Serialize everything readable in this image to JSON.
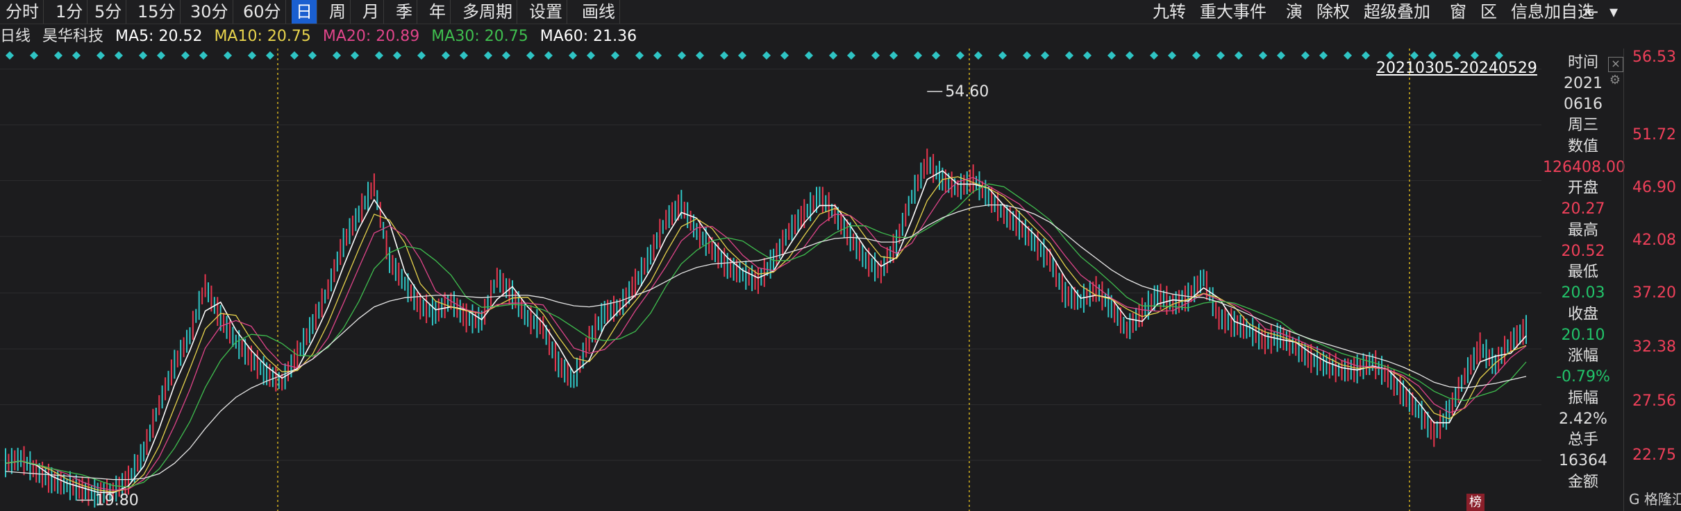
{
  "toolbar": {
    "tabs": [
      {
        "label": "分时",
        "active": false
      },
      {
        "label": "1分",
        "active": false
      },
      {
        "label": "5分",
        "active": false
      },
      {
        "label": "15分",
        "active": false
      },
      {
        "label": "30分",
        "active": false
      },
      {
        "label": "60分",
        "active": false
      },
      {
        "label": "日",
        "active": true
      },
      {
        "label": "周",
        "active": false
      },
      {
        "label": "月",
        "active": false
      },
      {
        "label": "季",
        "active": false
      },
      {
        "label": "年",
        "active": false
      },
      {
        "label": "多周期",
        "active": false
      },
      {
        "label": "设置",
        "active": false
      },
      {
        "label": "画线",
        "active": false
      }
    ],
    "right_tools": [
      "九转",
      "重大事件",
      "演",
      "除权",
      "超级叠加",
      "窗",
      "区",
      "信息加自选"
    ],
    "active_color": "#1a5fd0"
  },
  "ma_bar": {
    "period": "日线",
    "stock_name": "昊华科技",
    "ma5": "MA5: 20.52",
    "ma10": "MA10: 20.75",
    "ma20": "MA20: 20.89",
    "ma30": "MA30: 20.75",
    "ma60": "MA60: 21.36",
    "colors": {
      "ma5": "#ffffff",
      "ma10": "#e8d44d",
      "ma20": "#e0458a",
      "ma30": "#3fbf4f",
      "ma60": "#ffffff"
    }
  },
  "y_axis": {
    "ticks": [
      "56.53",
      "51.72",
      "46.90",
      "42.08",
      "37.20",
      "32.38",
      "27.56",
      "22.75"
    ],
    "color": "#f0405a"
  },
  "info_panel": {
    "date_range": "20210305-20240529",
    "items": [
      {
        "label": "时间",
        "value_lines": [
          "2021",
          "0616",
          "周三"
        ],
        "color": "white"
      },
      {
        "label": "数值",
        "value_lines": [
          "126408.00"
        ],
        "color": "red"
      },
      {
        "label": "开盘",
        "value_lines": [
          "20.27"
        ],
        "color": "red"
      },
      {
        "label": "最高",
        "value_lines": [
          "20.52"
        ],
        "color": "red"
      },
      {
        "label": "最低",
        "value_lines": [
          "20.03"
        ],
        "color": "green"
      },
      {
        "label": "收盘",
        "value_lines": [
          "20.10"
        ],
        "color": "green"
      },
      {
        "label": "涨幅",
        "value_lines": [
          "-0.79%"
        ],
        "color": "green"
      },
      {
        "label": "振幅",
        "value_lines": [
          "2.42%"
        ],
        "color": "white"
      },
      {
        "label": "总手",
        "value_lines": [
          "16364"
        ],
        "color": "white"
      },
      {
        "label": "金额",
        "value_lines": [],
        "color": "white"
      }
    ]
  },
  "chart_data": {
    "type": "line",
    "title": "",
    "xlabel": "",
    "ylabel": "",
    "ylim": [
      20.0,
      58.0
    ],
    "annotations": [
      {
        "text": "54.60",
        "kind": "high",
        "value": 54.6
      },
      {
        "text": "19.80",
        "kind": "low",
        "value": 19.8
      }
    ],
    "price": [
      22.5,
      22.9,
      21.8,
      21.0,
      20.6,
      20.2,
      19.8,
      20.1,
      21.0,
      23.5,
      27.5,
      31.0,
      33.5,
      37.8,
      35.0,
      33.0,
      31.5,
      30.2,
      29.5,
      31.8,
      34.5,
      37.5,
      41.5,
      44.0,
      46.5,
      40.0,
      38.0,
      36.0,
      35.5,
      36.5,
      35.0,
      34.8,
      38.5,
      37.0,
      35.0,
      34.2,
      31.0,
      29.6,
      33.2,
      35.5,
      36.0,
      38.0,
      40.5,
      43.5,
      44.8,
      42.5,
      41.0,
      39.5,
      38.8,
      38.2,
      40.0,
      42.5,
      44.0,
      45.5,
      44.0,
      42.0,
      40.0,
      39.0,
      41.5,
      45.5,
      48.5,
      47.0,
      46.2,
      47.0,
      45.5,
      44.0,
      43.0,
      41.5,
      40.0,
      37.0,
      36.5,
      37.5,
      36.0,
      34.0,
      35.5,
      37.0,
      36.2,
      36.8,
      38.5,
      35.0,
      34.5,
      34.0,
      33.0,
      33.4,
      32.5,
      31.5,
      31.0,
      30.5,
      30.6,
      31.2,
      30.0,
      28.5,
      27.0,
      25.0,
      27.0,
      30.0,
      32.5,
      31.0,
      33.0,
      34.0
    ],
    "ma_long": [
      21.8,
      21.7,
      21.6,
      21.5,
      21.4,
      21.3,
      21.2,
      21.1,
      21.1,
      21.2,
      21.6,
      22.5,
      23.8,
      25.5,
      27.0,
      28.2,
      29.0,
      29.6,
      30.1,
      30.7,
      31.5,
      32.6,
      33.8,
      35.0,
      36.0,
      36.5,
      36.8,
      36.9,
      37.0,
      37.0,
      36.9,
      36.8,
      36.9,
      37.0,
      37.0,
      36.8,
      36.4,
      36.1,
      36.0,
      36.2,
      36.5,
      37.0,
      37.5,
      38.2,
      38.9,
      39.4,
      39.7,
      39.8,
      39.9,
      40.0,
      40.3,
      40.7,
      41.1,
      41.6,
      41.9,
      42.0,
      41.9,
      41.6,
      41.6,
      42.1,
      43.0,
      43.7,
      44.2,
      44.6,
      44.8,
      44.8,
      44.5,
      44.0,
      43.3,
      42.3,
      41.2,
      40.2,
      39.2,
      38.4,
      37.8,
      37.4,
      37.1,
      36.9,
      36.8,
      36.4,
      35.9,
      35.3,
      34.7,
      34.2,
      33.7,
      33.2,
      32.8,
      32.4,
      32.0,
      31.7,
      31.3,
      30.8,
      30.2,
      29.5,
      29.1,
      29.0,
      29.2,
      29.4,
      29.7,
      30.0
    ],
    "signal_dots_note": "markers row"
  }
}
